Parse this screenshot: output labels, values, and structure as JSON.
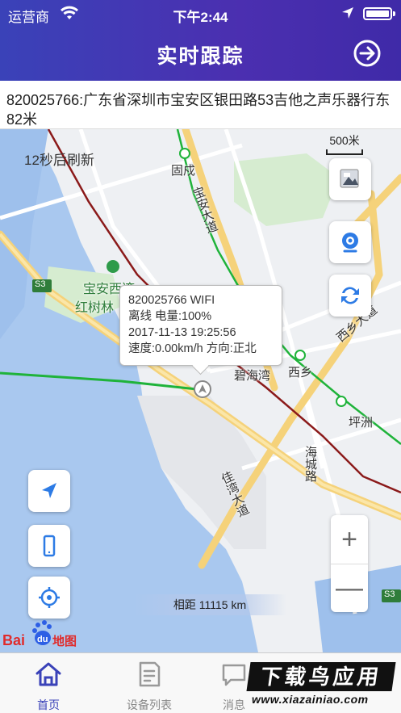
{
  "status_bar": {
    "carrier": "运营商",
    "time": "下午2:44"
  },
  "nav": {
    "title": "实时跟踪",
    "exit_icon": "exit-arrow-icon"
  },
  "address": "820025766:广东省深圳市宝安区银田路53吉他之声乐器行东82米",
  "map": {
    "refresh_text": "12秒后刷新",
    "scale_text": "500米",
    "labels": {
      "gutang": "固戍",
      "baoan_ave": "宝安大道",
      "baoan_park": "宝安西湾",
      "mangrove": "红树林",
      "s3_a": "S3",
      "s3_b": "S3",
      "bihaiwan": "碧海湾",
      "xixiang": "西乡",
      "xixiang_ave": "西乡大道",
      "pingzhou": "坪洲",
      "haicheng_rd": "海城路",
      "jiawan_ave": "佳湾大道"
    },
    "callout": {
      "line1": "820025766  WIFI",
      "line2": "离线 电量:100%",
      "line3": "2017-11-13 19:25:56",
      "line4": "速度:0.00km/h 方向:正北"
    },
    "distance": "相距  11115 km",
    "zoom_in": "+",
    "zoom_out": "—",
    "logo_text": "Baidu地图",
    "buttons": {
      "layer": "map-layer-icon",
      "camera": "webcam-icon",
      "refresh": "refresh-icon",
      "navigate": "navigation-arrow-icon",
      "device": "phone-icon",
      "locate": "crosshair-icon"
    }
  },
  "tabs": [
    {
      "label": "首页",
      "icon": "home-icon",
      "active": true
    },
    {
      "label": "设备列表",
      "icon": "list-doc-icon",
      "active": false
    },
    {
      "label": "消息",
      "icon": "message-icon",
      "active": false
    }
  ],
  "watermark": {
    "title": "下载鸟应用",
    "url": "www.xiazainiao.com"
  },
  "colors": {
    "header_start": "#3a42b8",
    "header_end": "#4b2fb0",
    "accent": "#3a42b8",
    "route_green": "#1fb33a",
    "rail_darkred": "#8b1a1a",
    "water": "#a9c8ef"
  }
}
